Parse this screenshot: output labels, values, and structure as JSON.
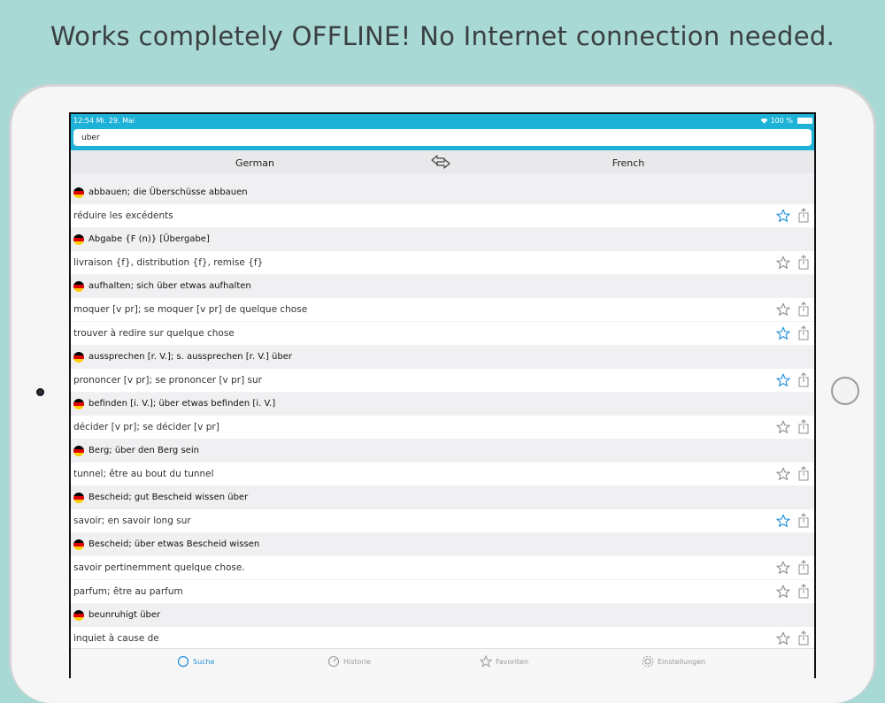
{
  "headline": "Works completely OFFLINE! No Internet connection needed.",
  "status_bar": {
    "time_date": "12:54   Mi. 29. Mai",
    "battery": "100 %"
  },
  "search": {
    "value": "uber",
    "placeholder": ""
  },
  "languages": {
    "from": "German",
    "to": "French"
  },
  "icons": {
    "flag": "german-flag-icon",
    "star": "star-icon",
    "share": "share-icon",
    "swap": "swap-arrows-icon",
    "search": "search-icon",
    "history": "clock-icon",
    "favorites": "star-icon",
    "settings": "gear-icon",
    "wifi": "wifi-icon"
  },
  "colors": {
    "accent": "#1eb2d8",
    "star_active": "#1e8fd6",
    "star_inactive": "#8e8e93",
    "header_row": "#f0f0f2"
  },
  "entries": [
    {
      "headword": "abbauen; die Überschüsse abbauen",
      "translations": [
        {
          "text": "réduire les excédents",
          "favorite": true
        }
      ]
    },
    {
      "headword": "Abgabe {F (n)} [Übergabe]",
      "translations": [
        {
          "text": "livraison {f}, distribution {f}, remise {f}",
          "favorite": false
        }
      ]
    },
    {
      "headword": "aufhalten; sich über etwas aufhalten",
      "translations": [
        {
          "text": "moquer [v pr]; se moquer [v pr] de quelque chose",
          "favorite": false
        },
        {
          "text": "trouver à redire sur quelque chose",
          "favorite": true
        }
      ]
    },
    {
      "headword": "aussprechen [r. V.]; s. aussprechen [r. V.] über",
      "translations": [
        {
          "text": "prononcer [v pr]; se prononcer [v pr] sur",
          "favorite": true
        }
      ]
    },
    {
      "headword": "befinden [i. V.]; über etwas befinden [i. V.]",
      "translations": [
        {
          "text": "décider [v pr]; se décider [v pr]",
          "favorite": false
        }
      ]
    },
    {
      "headword": "Berg; über den Berg sein",
      "translations": [
        {
          "text": "tunnel; être au bout du tunnel",
          "favorite": false
        }
      ]
    },
    {
      "headword": "Bescheid; gut Bescheid wissen über",
      "translations": [
        {
          "text": "savoir; en savoir long sur",
          "favorite": true
        }
      ]
    },
    {
      "headword": "Bescheid; über etwas Bescheid wissen",
      "translations": [
        {
          "text": "savoir pertinemment quelque chose.",
          "favorite": false
        },
        {
          "text": "parfum; être au parfum",
          "favorite": false
        }
      ]
    },
    {
      "headword": "beunruhigt über",
      "translations": [
        {
          "text": "inquiet à cause de",
          "favorite": false
        }
      ]
    }
  ],
  "tabs": [
    {
      "label": "Suche",
      "icon": "search-icon",
      "active": true
    },
    {
      "label": "Historie",
      "icon": "clock-icon",
      "active": false
    },
    {
      "label": "Favoriten",
      "icon": "star-icon",
      "active": false
    },
    {
      "label": "Einstellungen",
      "icon": "gear-icon",
      "active": false
    }
  ]
}
